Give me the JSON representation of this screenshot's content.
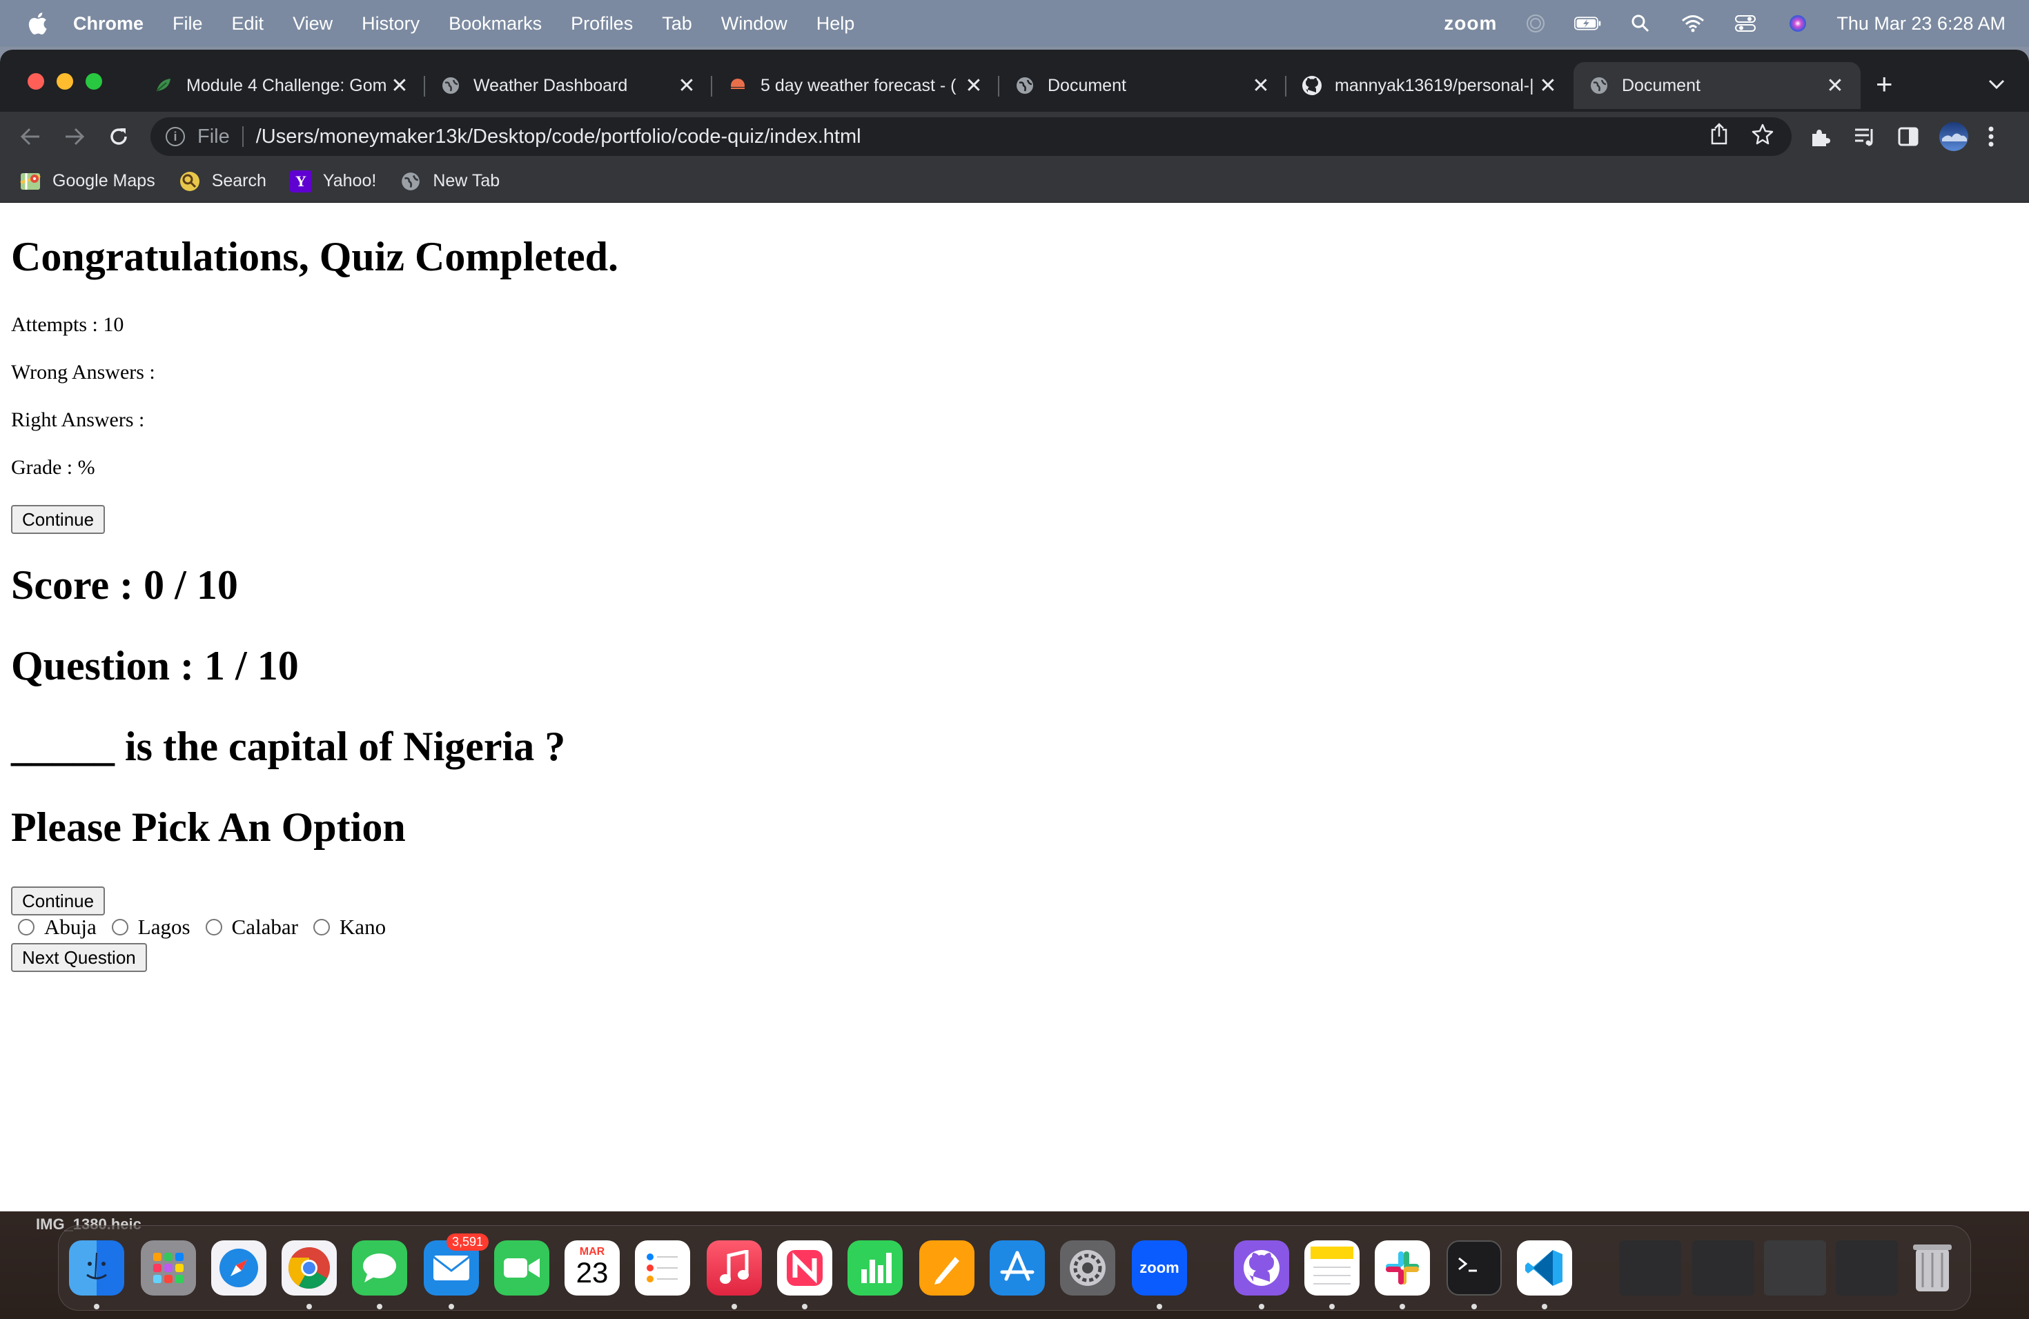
{
  "menubar": {
    "app": "Chrome",
    "menus": [
      "File",
      "Edit",
      "View",
      "History",
      "Bookmarks",
      "Profiles",
      "Tab",
      "Window",
      "Help"
    ],
    "zoom_label": "zoom",
    "datetime": "Thu Mar 23  6:28 AM"
  },
  "tabs": [
    {
      "title": "Module 4 Challenge: Gom",
      "icon": "leaf-icon",
      "close": "✕"
    },
    {
      "title": "Weather Dashboard",
      "icon": "globe-icon",
      "close": "✕"
    },
    {
      "title": "5 day weather forecast - (",
      "icon": "weather-icon",
      "close": "✕"
    },
    {
      "title": "Document",
      "icon": "globe-icon",
      "close": "✕"
    },
    {
      "title": "mannyak13619/personal-|",
      "icon": "github-icon",
      "close": "✕"
    },
    {
      "title": "Document",
      "icon": "globe-icon",
      "close": "✕"
    }
  ],
  "toolbar": {
    "scheme_label": "File",
    "url": "/Users/moneymaker13k/Desktop/code/portfolio/code-quiz/index.html"
  },
  "bookmarks": [
    {
      "label": "Google Maps",
      "icon": "maps-icon"
    },
    {
      "label": "Search",
      "icon": "search-app-icon"
    },
    {
      "label": "Yahoo!",
      "icon": "yahoo-icon"
    },
    {
      "label": "New Tab",
      "icon": "globe-icon"
    }
  ],
  "page": {
    "heading": "Congratulations, Quiz Completed.",
    "attempts": "Attempts : 10",
    "wrong": "Wrong Answers :",
    "right": "Right Answers :",
    "grade": "Grade : %",
    "continue_label": "Continue",
    "score": "Score : 0 / 10",
    "question_counter": "Question : 1 / 10",
    "question": "_____ is the capital of Nigeria ?",
    "prompt": "Please Pick An Option",
    "continue_label_2": "Continue",
    "options": [
      "Abuja",
      "Lagos",
      "Calabar",
      "Kano"
    ],
    "next_label": "Next Question"
  },
  "dock": {
    "mail_badge": "3,591",
    "calendar_month": "MAR",
    "calendar_day": "23",
    "zoom_label": "zoom",
    "caption": "IMG_1380.heic"
  }
}
